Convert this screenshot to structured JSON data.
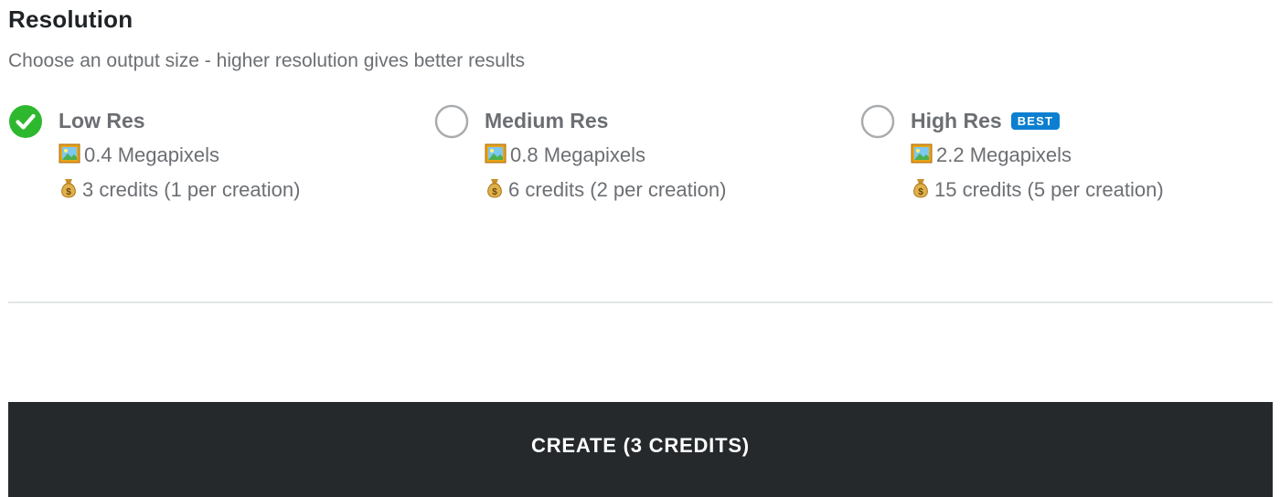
{
  "resolution": {
    "title": "Resolution",
    "subtitle": "Choose an output size - higher resolution gives better results",
    "options": [
      {
        "title": "Low Res",
        "megapixels": "0.4 Megapixels",
        "credits": "3 credits (1 per creation)",
        "selected": true,
        "badge": ""
      },
      {
        "title": "Medium Res",
        "megapixels": "0.8 Megapixels",
        "credits": "6 credits (2 per creation)",
        "selected": false,
        "badge": ""
      },
      {
        "title": "High Res",
        "megapixels": "2.2 Megapixels",
        "credits": "15 credits (5 per creation)",
        "selected": false,
        "badge": "BEST"
      }
    ]
  },
  "icons": {
    "selected": "check-circle-icon",
    "unselected": "radio-circle-icon",
    "megapixels": "framed-picture-icon",
    "credits": "money-bag-icon"
  },
  "colors": {
    "check": "#2eb82e",
    "badge": "#0d7fd0",
    "button_bg": "#26292c"
  },
  "create_button": {
    "label": "CREATE (3 CREDITS)"
  }
}
